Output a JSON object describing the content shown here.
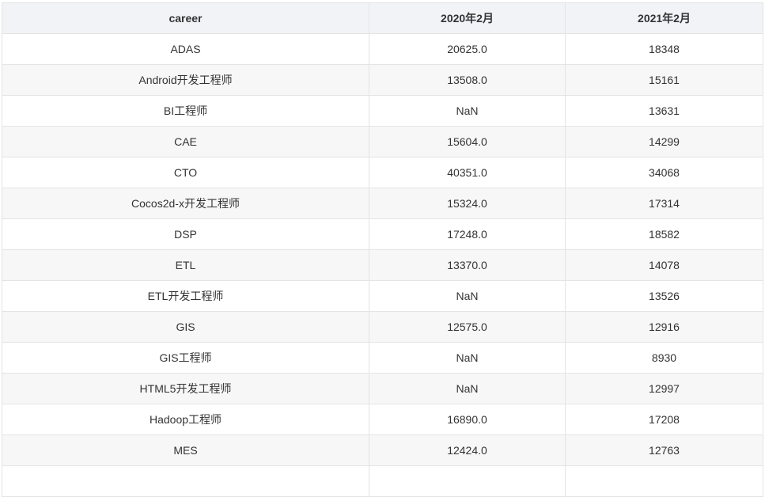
{
  "table": {
    "headers": [
      "career",
      "2020年2月",
      "2021年2月"
    ],
    "rows": [
      [
        "ADAS",
        "20625.0",
        "18348"
      ],
      [
        "Android开发工程师",
        "13508.0",
        "15161"
      ],
      [
        "BI工程师",
        "NaN",
        "13631"
      ],
      [
        "CAE",
        "15604.0",
        "14299"
      ],
      [
        "CTO",
        "40351.0",
        "34068"
      ],
      [
        "Cocos2d-x开发工程师",
        "15324.0",
        "17314"
      ],
      [
        "DSP",
        "17248.0",
        "18582"
      ],
      [
        "ETL",
        "13370.0",
        "14078"
      ],
      [
        "ETL开发工程师",
        "NaN",
        "13526"
      ],
      [
        "GIS",
        "12575.0",
        "12916"
      ],
      [
        "GIS工程师",
        "NaN",
        "8930"
      ],
      [
        "HTML5开发工程师",
        "NaN",
        "12997"
      ],
      [
        "Hadoop工程师",
        "16890.0",
        "17208"
      ],
      [
        "MES",
        "12424.0",
        "12763"
      ],
      [
        "",
        "",
        ""
      ]
    ]
  }
}
